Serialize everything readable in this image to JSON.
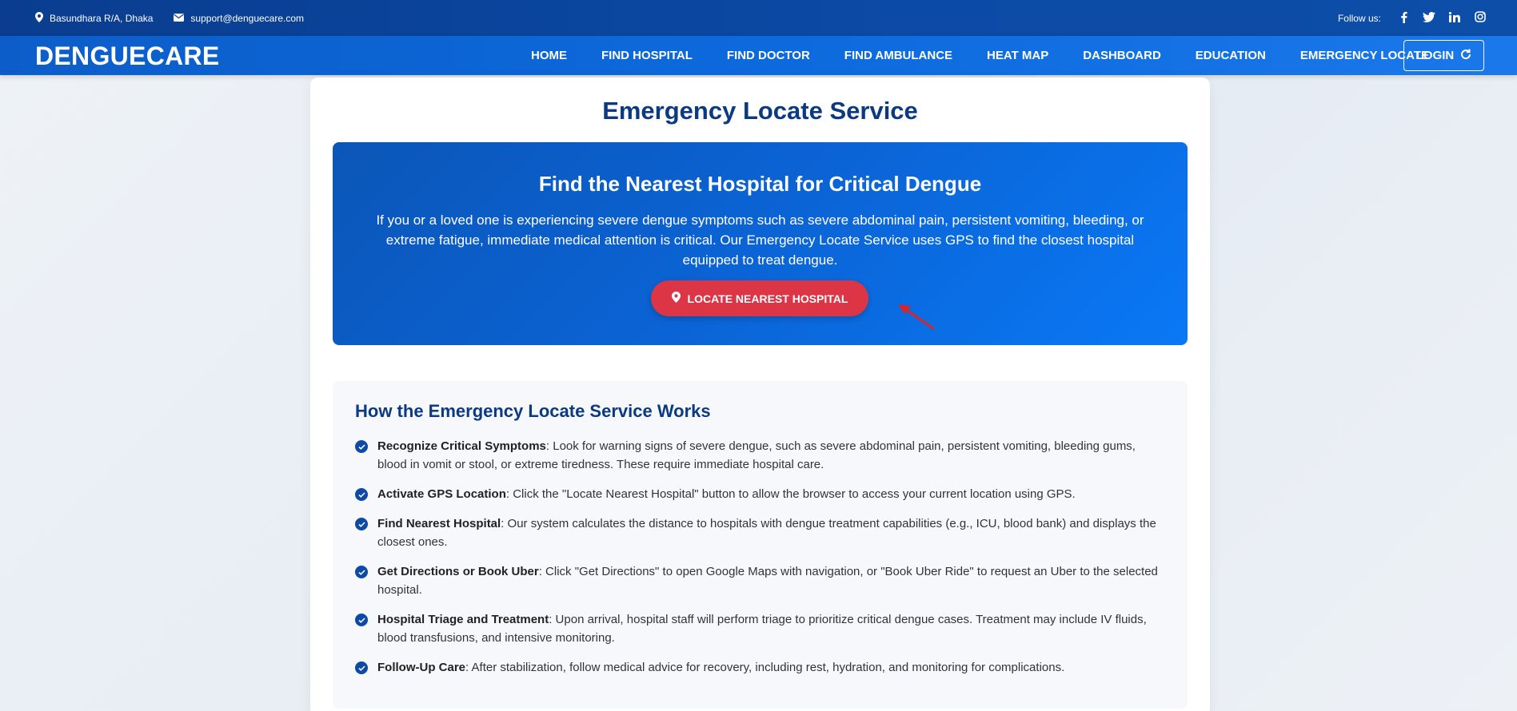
{
  "topbar": {
    "address": "Basundhara R/A, Dhaka",
    "email": "support@denguecare.com",
    "follow_label": "Follow us:",
    "socials": [
      {
        "icon": "facebook-icon",
        "glyph": "f"
      },
      {
        "icon": "twitter-icon",
        "glyph": "🐦"
      },
      {
        "icon": "linkedin-icon",
        "glyph": "in"
      },
      {
        "icon": "instagram-icon",
        "glyph": "◎"
      }
    ]
  },
  "nav": {
    "brand": "DENGUECARE",
    "links": [
      "HOME",
      "FIND HOSPITAL",
      "FIND DOCTOR",
      "FIND AMBULANCE",
      "HEAT MAP",
      "DASHBOARD",
      "EDUCATION",
      "EMERGENCY LOCATE"
    ],
    "login": "LOGIN"
  },
  "page": {
    "title": "Emergency Locate Service"
  },
  "hero": {
    "heading": "Find the Nearest Hospital for Critical Dengue",
    "description": "If you or a loved one is experiencing severe dengue symptoms such as severe abdominal pain, persistent vomiting, bleeding, or extreme fatigue, immediate medical attention is critical. Our Emergency Locate Service uses GPS to find the closest hospital equipped to treat dengue.",
    "button": "LOCATE NEAREST HOSPITAL"
  },
  "how": {
    "heading": "How the Emergency Locate Service Works",
    "steps": [
      {
        "title": "Recognize Critical Symptoms",
        "text": ": Look for warning signs of severe dengue, such as severe abdominal pain, persistent vomiting, bleeding gums, blood in vomit or stool, or extreme tiredness. These require immediate hospital care."
      },
      {
        "title": "Activate GPS Location",
        "text": ": Click the \"Locate Nearest Hospital\" button to allow the browser to access your current location using GPS."
      },
      {
        "title": "Find Nearest Hospital",
        "text": ": Our system calculates the distance to hospitals with dengue treatment capabilities (e.g., ICU, blood bank) and displays the closest ones."
      },
      {
        "title": "Get Directions or Book Uber",
        "text": ": Click \"Get Directions\" to open Google Maps with navigation, or \"Book Uber Ride\" to request an Uber to the selected hospital."
      },
      {
        "title": "Hospital Triage and Treatment",
        "text": ": Upon arrival, hospital staff will perform triage to prioritize critical dengue cases. Treatment may include IV fluids, blood transfusions, and intensive monitoring."
      },
      {
        "title": "Follow-Up Care",
        "text": ": After stabilization, follow medical advice for recovery, including rest, hydration, and monitoring for complications."
      }
    ]
  },
  "colors": {
    "primary": "#0b4aa6",
    "accent_red": "#dc3545",
    "title_blue": "#0b3a82"
  }
}
